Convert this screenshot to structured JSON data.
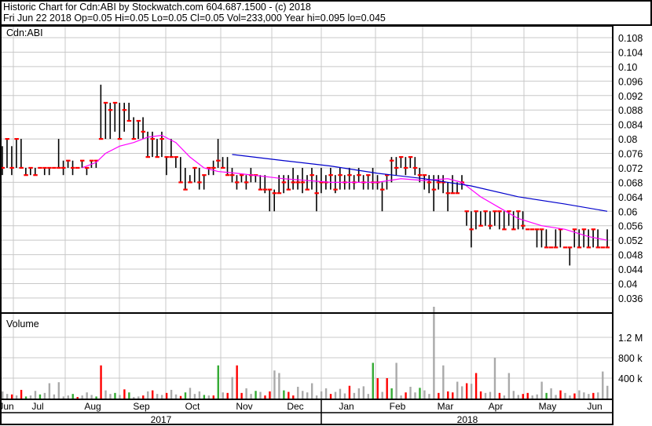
{
  "header": {
    "line1": "Historic Chart for Cdn:ABI by Stockwatch.com 604.687.1500 - (c) 2018",
    "line2": "Fri Jun 22 2018  Op=0.05  Hi=0.05  Lo=0.05  Cl=0.05  Vol=233,000  Year hi=0.095  lo=0.045"
  },
  "chart_data": {
    "type": "line",
    "title": "Cdn:ABI",
    "colors": {
      "up": "#ff0000",
      "bar": "#000000",
      "ma_short": "#ff00ff",
      "ma_long": "#0000cc",
      "vol_up": "#33aa33",
      "vol_down": "#ff0000",
      "vol_flat": "#aaaaaa",
      "grid": "#c8c8c8"
    },
    "price_axis": {
      "ylim": [
        0.032,
        0.112
      ],
      "ticks": [
        "0.108",
        "0.104",
        "0.10",
        "0.096",
        "0.092",
        "0.088",
        "0.084",
        "0.08",
        "0.076",
        "0.072",
        "0.068",
        "0.064",
        "0.06",
        "0.056",
        "0.052",
        "0.048",
        "0.044",
        "0.04",
        "0.036"
      ]
    },
    "bars_hlc": [
      [
        0.078,
        0.07,
        0.072
      ],
      [
        0.08,
        0.072,
        0.08
      ],
      [
        0.078,
        0.07,
        0.072
      ],
      [
        0.08,
        0.072,
        0.08
      ],
      [
        0.08,
        0.072,
        0.072
      ],
      [
        0.072,
        0.07,
        0.07
      ],
      [
        0.072,
        0.07,
        0.072
      ],
      [
        0.072,
        0.07,
        0.07
      ],
      [
        0.072,
        0.072,
        0.072
      ],
      [
        0.072,
        0.07,
        0.072
      ],
      [
        0.072,
        0.07,
        0.072
      ],
      [
        0.072,
        0.072,
        0.072
      ],
      [
        0.08,
        0.072,
        0.072
      ],
      [
        0.074,
        0.07,
        0.072
      ],
      [
        0.074,
        0.072,
        0.074
      ],
      [
        0.074,
        0.07,
        0.072
      ],
      [
        0.072,
        0.072,
        0.072
      ],
      [
        0.074,
        0.072,
        0.074
      ],
      [
        0.072,
        0.07,
        0.072
      ],
      [
        0.074,
        0.072,
        0.074
      ],
      [
        0.074,
        0.072,
        0.074
      ],
      [
        0.095,
        0.08,
        0.08
      ],
      [
        0.09,
        0.08,
        0.09
      ],
      [
        0.09,
        0.08,
        0.088
      ],
      [
        0.09,
        0.082,
        0.09
      ],
      [
        0.09,
        0.08,
        0.08
      ],
      [
        0.09,
        0.082,
        0.088
      ],
      [
        0.09,
        0.085,
        0.085
      ],
      [
        0.086,
        0.08,
        0.08
      ],
      [
        0.085,
        0.08,
        0.085
      ],
      [
        0.086,
        0.08,
        0.082
      ],
      [
        0.082,
        0.075,
        0.075
      ],
      [
        0.082,
        0.075,
        0.08
      ],
      [
        0.08,
        0.075,
        0.075
      ],
      [
        0.082,
        0.075,
        0.08
      ],
      [
        0.075,
        0.07,
        0.075
      ],
      [
        0.08,
        0.075,
        0.075
      ],
      [
        0.075,
        0.072,
        0.075
      ],
      [
        0.075,
        0.068,
        0.068
      ],
      [
        0.072,
        0.066,
        0.066
      ],
      [
        0.07,
        0.068,
        0.068
      ],
      [
        0.072,
        0.068,
        0.072
      ],
      [
        0.072,
        0.066,
        0.068
      ],
      [
        0.07,
        0.066,
        0.07
      ],
      [
        0.072,
        0.07,
        0.072
      ],
      [
        0.074,
        0.07,
        0.072
      ],
      [
        0.08,
        0.072,
        0.074
      ],
      [
        0.075,
        0.072,
        0.072
      ],
      [
        0.075,
        0.07,
        0.07
      ],
      [
        0.072,
        0.068,
        0.07
      ],
      [
        0.07,
        0.066,
        0.068
      ],
      [
        0.07,
        0.068,
        0.07
      ],
      [
        0.07,
        0.066,
        0.068
      ],
      [
        0.072,
        0.068,
        0.07
      ],
      [
        0.07,
        0.068,
        0.07
      ],
      [
        0.07,
        0.066,
        0.066
      ],
      [
        0.07,
        0.065,
        0.066
      ],
      [
        0.066,
        0.06,
        0.066
      ],
      [
        0.066,
        0.06,
        0.065
      ],
      [
        0.07,
        0.065,
        0.065
      ],
      [
        0.07,
        0.065,
        0.068
      ],
      [
        0.07,
        0.066,
        0.066
      ],
      [
        0.072,
        0.066,
        0.068
      ],
      [
        0.07,
        0.066,
        0.068
      ],
      [
        0.072,
        0.065,
        0.068
      ],
      [
        0.07,
        0.066,
        0.066
      ],
      [
        0.072,
        0.066,
        0.07
      ],
      [
        0.07,
        0.06,
        0.065
      ],
      [
        0.072,
        0.065,
        0.068
      ],
      [
        0.07,
        0.066,
        0.068
      ],
      [
        0.072,
        0.066,
        0.07
      ],
      [
        0.07,
        0.065,
        0.066
      ],
      [
        0.072,
        0.066,
        0.07
      ],
      [
        0.07,
        0.066,
        0.068
      ],
      [
        0.072,
        0.066,
        0.07
      ],
      [
        0.07,
        0.066,
        0.068
      ],
      [
        0.072,
        0.068,
        0.07
      ],
      [
        0.07,
        0.066,
        0.068
      ],
      [
        0.07,
        0.066,
        0.07
      ],
      [
        0.072,
        0.066,
        0.068
      ],
      [
        0.07,
        0.066,
        0.068
      ],
      [
        0.068,
        0.06,
        0.066
      ],
      [
        0.07,
        0.066,
        0.07
      ],
      [
        0.075,
        0.068,
        0.074
      ],
      [
        0.075,
        0.07,
        0.072
      ],
      [
        0.075,
        0.072,
        0.075
      ],
      [
        0.075,
        0.07,
        0.072
      ],
      [
        0.075,
        0.072,
        0.075
      ],
      [
        0.075,
        0.07,
        0.072
      ],
      [
        0.072,
        0.068,
        0.07
      ],
      [
        0.07,
        0.066,
        0.07
      ],
      [
        0.07,
        0.065,
        0.068
      ],
      [
        0.07,
        0.06,
        0.066
      ],
      [
        0.07,
        0.066,
        0.068
      ],
      [
        0.07,
        0.065,
        0.068
      ],
      [
        0.068,
        0.06,
        0.065
      ],
      [
        0.07,
        0.065,
        0.065
      ],
      [
        0.068,
        0.065,
        0.065
      ],
      [
        0.07,
        0.066,
        0.068
      ],
      [
        0.06,
        0.056,
        0.06
      ],
      [
        0.06,
        0.05,
        0.055
      ],
      [
        0.06,
        0.055,
        0.06
      ],
      [
        0.06,
        0.056,
        0.056
      ],
      [
        0.06,
        0.056,
        0.06
      ],
      [
        0.06,
        0.055,
        0.056
      ],
      [
        0.06,
        0.056,
        0.06
      ],
      [
        0.06,
        0.055,
        0.06
      ],
      [
        0.06,
        0.055,
        0.055
      ],
      [
        0.06,
        0.056,
        0.06
      ],
      [
        0.06,
        0.055,
        0.055
      ],
      [
        0.06,
        0.055,
        0.06
      ],
      [
        0.06,
        0.055,
        0.056
      ],
      [
        0.055,
        0.055,
        0.055
      ],
      [
        0.055,
        0.055,
        0.055
      ],
      [
        0.055,
        0.05,
        0.055
      ],
      [
        0.055,
        0.05,
        0.055
      ],
      [
        0.055,
        0.05,
        0.05
      ],
      [
        0.05,
        0.05,
        0.05
      ],
      [
        0.055,
        0.05,
        0.05
      ],
      [
        0.055,
        0.05,
        0.055
      ],
      [
        0.05,
        0.05,
        0.05
      ],
      [
        0.05,
        0.045,
        0.05
      ],
      [
        0.055,
        0.05,
        0.055
      ],
      [
        0.055,
        0.05,
        0.05
      ],
      [
        0.055,
        0.05,
        0.055
      ],
      [
        0.055,
        0.05,
        0.05
      ],
      [
        0.055,
        0.05,
        0.055
      ],
      [
        0.055,
        0.05,
        0.05
      ],
      [
        0.05,
        0.05,
        0.05
      ],
      [
        0.055,
        0.05,
        0.05
      ]
    ],
    "ma_short": [
      [
        17,
        0.072
      ],
      [
        20,
        0.0735
      ],
      [
        22,
        0.076
      ],
      [
        25,
        0.078
      ],
      [
        28,
        0.079
      ],
      [
        31,
        0.0805
      ],
      [
        34,
        0.081
      ],
      [
        37,
        0.079
      ],
      [
        40,
        0.075
      ],
      [
        43,
        0.072
      ],
      [
        46,
        0.071
      ],
      [
        50,
        0.0705
      ],
      [
        60,
        0.069
      ],
      [
        70,
        0.068
      ],
      [
        80,
        0.068
      ],
      [
        85,
        0.069
      ],
      [
        90,
        0.0685
      ],
      [
        95,
        0.069
      ],
      [
        98,
        0.068
      ],
      [
        102,
        0.064
      ],
      [
        106,
        0.061
      ],
      [
        110,
        0.058
      ],
      [
        115,
        0.056
      ],
      [
        120,
        0.055
      ],
      [
        125,
        0.053
      ],
      [
        129,
        0.052
      ]
    ],
    "ma_long": [
      [
        49,
        0.0757
      ],
      [
        60,
        0.074
      ],
      [
        70,
        0.0725
      ],
      [
        80,
        0.0705
      ],
      [
        90,
        0.069
      ],
      [
        100,
        0.067
      ],
      [
        110,
        0.064
      ],
      [
        120,
        0.062
      ],
      [
        129,
        0.06
      ]
    ],
    "volume": {
      "label": "Volume",
      "ylim_k": [
        0,
        1600
      ],
      "ticks": [
        {
          "label": "1.2 M",
          "v": 1200
        },
        {
          "label": "800 k",
          "v": 800
        },
        {
          "label": "400 k",
          "v": 400
        }
      ],
      "values_k": [
        140,
        90,
        80,
        60,
        170,
        40,
        60,
        150,
        80,
        110,
        300,
        80,
        320,
        40,
        60,
        90,
        30,
        60,
        120,
        70,
        40,
        650,
        160,
        90,
        110,
        70,
        180,
        120,
        30,
        40,
        60,
        140,
        160,
        90,
        70,
        110,
        170,
        80,
        50,
        120,
        210,
        90,
        140,
        70,
        60,
        60,
        650,
        120,
        110,
        420,
        650,
        110,
        200,
        90,
        150,
        130,
        60,
        140,
        550,
        500,
        160,
        130,
        60,
        230,
        150,
        120,
        300,
        60,
        140,
        200,
        90,
        130,
        190,
        100,
        250,
        110,
        200,
        240,
        90,
        700,
        400,
        130,
        400,
        200,
        700,
        60,
        120,
        230,
        120,
        210,
        160,
        90,
        1800,
        110,
        650,
        140,
        120,
        330,
        240,
        300,
        290,
        500,
        140,
        110,
        130,
        800,
        110,
        60,
        500,
        150,
        70,
        90,
        110,
        60,
        80,
        330,
        110,
        200,
        70,
        160,
        110,
        60,
        100,
        160,
        120,
        90,
        110,
        120,
        530,
        250
      ],
      "colors": "nnrnrgnngnnnnnngrnnngrnngnrgnnrnrnnrnnrgnnngnrgnrnrrnngnrrnngrrnnnnnnnrnnnrnnnngrnrgnnrnngnnnrnrrnnrnrrnnnrnnnnrrnnngnnrnnrnnnrn"
    },
    "x_axis": {
      "months": [
        "Jun",
        "Jul",
        "Aug",
        "Sep",
        "Oct",
        "Nov",
        "Dec",
        "Jan",
        "Feb",
        "Mar",
        "Apr",
        "May",
        "Jun"
      ],
      "years": [
        "2017",
        "2018"
      ]
    }
  }
}
